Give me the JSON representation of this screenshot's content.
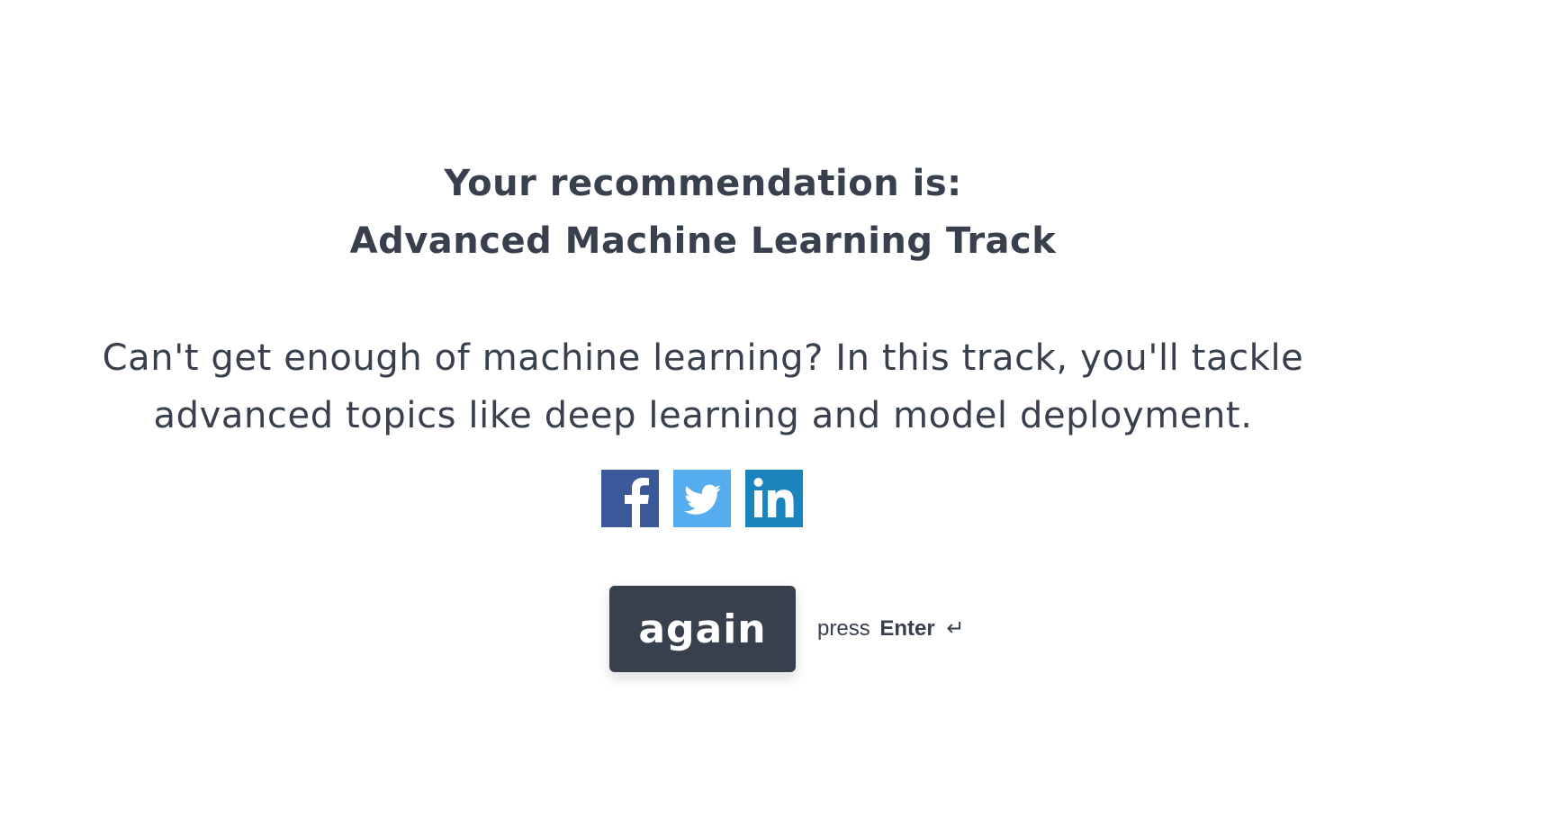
{
  "result": {
    "intro": "Your recommendation is:",
    "track": "Advanced Machine Learning Track"
  },
  "description": {
    "line1": "Can't get enough of machine learning? In this track, you'll tackle",
    "line2": "advanced topics like deep learning and model deployment."
  },
  "social": {
    "facebook": {
      "icon": "facebook-icon",
      "color": "#3b5998"
    },
    "twitter": {
      "icon": "twitter-icon",
      "color": "#55acee"
    },
    "linkedin": {
      "icon": "linkedin-icon",
      "color": "#1a84bc"
    }
  },
  "actions": {
    "again_label": "again",
    "hint_prefix": "press",
    "hint_key": "Enter",
    "hint_icon": "↵"
  },
  "colors": {
    "text": "#39404d",
    "button_bg": "#39404d",
    "button_text": "#ffffff",
    "background": "#ffffff"
  }
}
